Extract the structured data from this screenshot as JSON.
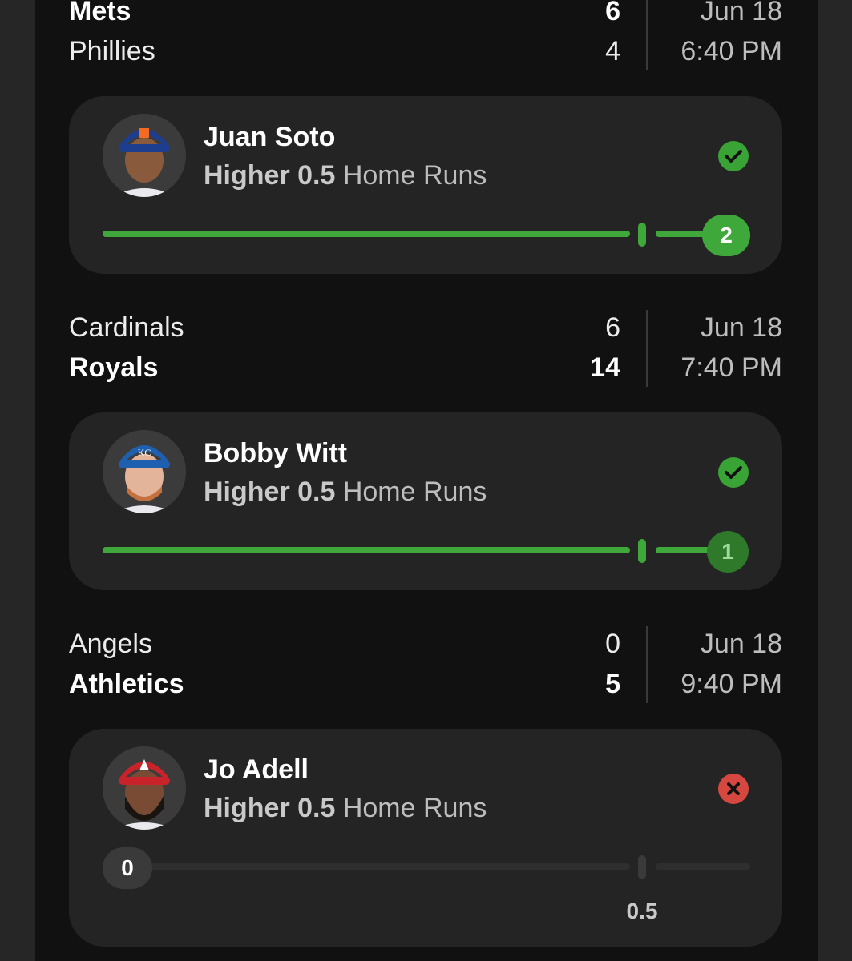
{
  "games": [
    {
      "team1": "Mets",
      "score1": "6",
      "team2": "Phillies",
      "score2": "4",
      "date": "Jun 18",
      "time": "6:40 PM",
      "winner": 1
    },
    {
      "team1": "Cardinals",
      "score1": "6",
      "team2": "Royals",
      "score2": "14",
      "date": "Jun 18",
      "time": "7:40 PM",
      "winner": 2
    },
    {
      "team1": "Angels",
      "score1": "0",
      "team2": "Athletics",
      "score2": "5",
      "date": "Jun 18",
      "time": "9:40 PM",
      "winner": 2
    }
  ],
  "picks": [
    {
      "player": "Juan Soto",
      "direction": "Higher 0.5",
      "stat": "Home Runs",
      "result": "2",
      "status": "won",
      "status_icon": "check-circle-icon",
      "progress_fraction": 1.0,
      "cap_color": "#1d3e8f"
    },
    {
      "player": "Bobby Witt",
      "direction": "Higher 0.5",
      "stat": "Home Runs",
      "result": "1",
      "status": "won",
      "status_icon": "check-circle-icon",
      "progress_fraction": 1.0,
      "cap_color": "#1f5fb0"
    },
    {
      "player": "Jo Adell",
      "direction": "Higher 0.5",
      "stat": "Home Runs",
      "result": "0",
      "status": "lost",
      "status_icon": "x-circle-icon",
      "progress_fraction": 0.0,
      "line_label": "0.5",
      "cap_color": "#c8232b"
    }
  ],
  "colors": {
    "win_green": "#3fa83a",
    "loss_red": "#d6483f",
    "track_gray": "#2e2e2e"
  }
}
